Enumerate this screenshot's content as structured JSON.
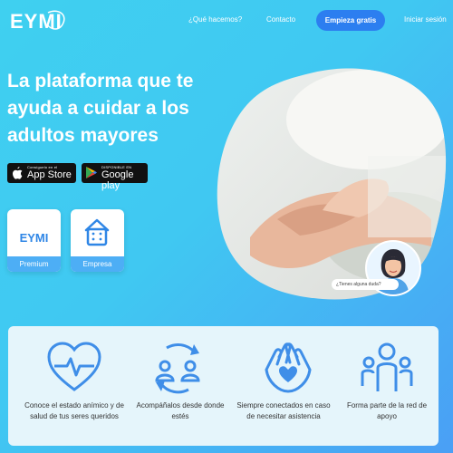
{
  "brand": {
    "name": "EYMI"
  },
  "nav": {
    "links": [
      "¿Qué hacemos?",
      "Contacto"
    ],
    "cta": "Empieza gratis",
    "login": "Iniciar sesión"
  },
  "hero": {
    "title": "La plataforma que te ayuda a cuidar a los adultos mayores"
  },
  "stores": {
    "apple_small": "Consíguelo en el",
    "apple_big": "App Store",
    "google_small": "DISPONIBLE EN",
    "google_big": "Google play"
  },
  "cards": [
    {
      "title": "EYMI",
      "footer": "Premium"
    },
    {
      "footer": "Empresa"
    }
  ],
  "chat": {
    "label": "¿Tienes alguna duda?"
  },
  "features": [
    {
      "text": "Conoce el estado anímico y de salud de tus seres queridos",
      "icon": "heart-pulse-icon"
    },
    {
      "text": "Acompáñalos desde donde estés",
      "icon": "people-sync-icon"
    },
    {
      "text": "Siempre conectados en caso de necesitar asistencia",
      "icon": "hands-heart-icon"
    },
    {
      "text": "Forma parte de la red de apoyo",
      "icon": "community-icon"
    }
  ],
  "colors": {
    "accent": "#2c7ef0",
    "primary": "#4daef5",
    "feature_blue": "#3f8ee8"
  }
}
